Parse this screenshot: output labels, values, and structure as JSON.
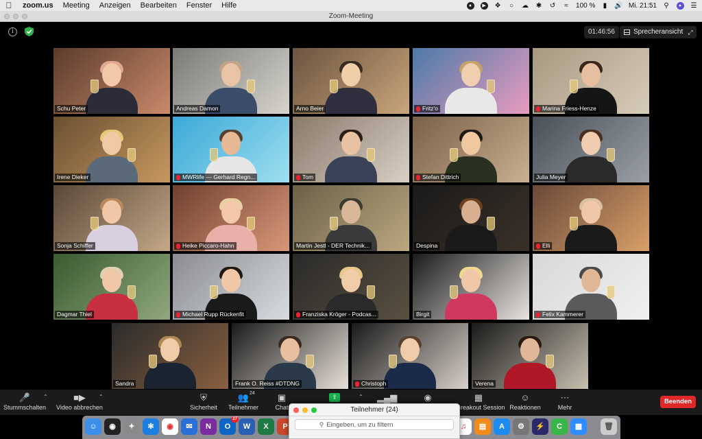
{
  "menubar": {
    "app_name": "zoom.us",
    "items": [
      "Meeting",
      "Anzeigen",
      "Bearbeiten",
      "Fenster",
      "Hilfe"
    ],
    "battery": "100 %",
    "clock": "Mi. 21:51"
  },
  "window": {
    "title": "Zoom-Meeting"
  },
  "meeting": {
    "timer": "01:46:56",
    "view_button": "Sprecheransicht"
  },
  "participants": [
    {
      "name": "Schu Peter",
      "muted": false
    },
    {
      "name": "Andreas Damon",
      "muted": false
    },
    {
      "name": "Arno Beier",
      "muted": false
    },
    {
      "name": "Fritz'o",
      "muted": true
    },
    {
      "name": "Marina Friess-Henze",
      "muted": true
    },
    {
      "name": "Irene Dieker",
      "muted": false
    },
    {
      "name": "MWRlife --- Gerhard Regn...",
      "muted": true
    },
    {
      "name": "Tom",
      "muted": true
    },
    {
      "name": "Stefan Dittrich",
      "muted": true
    },
    {
      "name": "Julia Meyer",
      "muted": false
    },
    {
      "name": "Sonja Schiffer",
      "muted": false
    },
    {
      "name": "Heike Piccaro-Hahn",
      "muted": true
    },
    {
      "name": "Martin Jestl - DER Technik...",
      "muted": false
    },
    {
      "name": "Despina",
      "muted": false
    },
    {
      "name": "Elli",
      "muted": true
    },
    {
      "name": "Dagmar Thiel",
      "muted": false
    },
    {
      "name": "Michael Rupp  Rückenfit",
      "muted": true
    },
    {
      "name": "Franziska Kröger - Podcas...",
      "muted": true
    },
    {
      "name": "Birgit",
      "muted": false
    },
    {
      "name": "Felix Kammerer",
      "muted": true
    },
    {
      "name": "Sandra",
      "muted": false
    },
    {
      "name": "Frank O. Reiss #DTDNG",
      "muted": false
    },
    {
      "name": "Christoph",
      "muted": true
    },
    {
      "name": "Verena",
      "muted": false
    }
  ],
  "toolbar": {
    "mute_label": "Stummschalten",
    "video_label": "Video abbrechen",
    "security_label": "Sicherheit",
    "participants_label": "Teilnehmer",
    "participants_count": "24",
    "chat_label": "Chat",
    "breakout_label": "Breakout Session",
    "reactions_label": "Reaktionen",
    "more_label": "Mehr",
    "end_label": "Beenden"
  },
  "participants_panel": {
    "title": "Teilnehmer (24)",
    "search_placeholder": "Eingeben, um zu filtern"
  },
  "dock": {
    "notes_badge": "27"
  },
  "colors": {
    "end_button": "#e02828",
    "share_button": "#19b24b",
    "active_speaker_outline": "#c8e35a",
    "muted_icon": "#e22233"
  }
}
